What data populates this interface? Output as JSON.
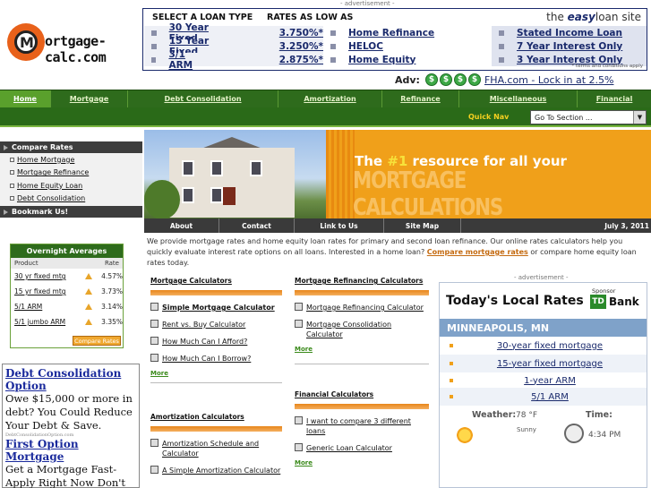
{
  "logo": {
    "letter": "M",
    "wordmark": "ortgage-calc.com"
  },
  "header_ad": {
    "label": "- advertisement -",
    "col_type": "SELECT A LOAN TYPE",
    "col_rates": "RATES AS LOW AS",
    "brand_pre": "the ",
    "brand_bold": "easy",
    "brand_post": "loan site",
    "loans": [
      {
        "name": "30 Year Fixed",
        "rate": "3.750%*"
      },
      {
        "name": "15 Year Fixed",
        "rate": "3.250%*"
      },
      {
        "name": "3/1 ARM",
        "rate": "2.875%*"
      }
    ],
    "mid_links": [
      "Home Refinance",
      "HELOC",
      "Home Equity"
    ],
    "right_links": [
      "Stated Income Loan",
      "7 Year Interest Only",
      "3 Year Interest Only"
    ],
    "terms": "* terms and conditions apply"
  },
  "adv": {
    "label": "Adv:",
    "coin": "$",
    "link": "FHA.com - Lock in at 2.5%"
  },
  "nav": {
    "tabs": [
      "Home",
      "Mortgage",
      "Debt Consolidation",
      "Amortization",
      "Refinance",
      "Miscellaneous",
      "Financial"
    ],
    "quick_nav_label": "Quick Nav",
    "quick_nav_value": "Go To Section ...",
    "arrow": "▼"
  },
  "sidebar": {
    "compare_title": "Compare Rates",
    "compare_items": [
      "Home Mortgage",
      "Mortgage Refinance",
      "Home Equity Loan",
      "Debt Consolidation"
    ],
    "bookmark_title": "Bookmark Us!"
  },
  "overnight": {
    "title": "Overnight Averages",
    "col_product": "Product",
    "col_rate": "Rate",
    "rows": [
      {
        "product": "30 yr fixed mtg",
        "rate": "4.57%"
      },
      {
        "product": "15 yr fixed mtg",
        "rate": "3.73%"
      },
      {
        "product": "5/1 ARM",
        "rate": "3.14%"
      },
      {
        "product": "5/1 jumbo ARM",
        "rate": "3.35%"
      }
    ],
    "button": "Compare Rates"
  },
  "promo": {
    "title1": "Debt Consolidation Option",
    "text1": "Owe $15,000 or more in debt? You Could Reduce Your Debt & Save.",
    "tiny": "DebtConsolidationOption.com",
    "title2": "First Option Mortgage",
    "text2": "Get a Mortgage Fast-Apply Right Now Don't wait for those big banks!"
  },
  "hero": {
    "line1_pre": "The ",
    "line1_accent": "#1",
    "line1_post": " resource for all your",
    "line2": "MORTGAGE CALCULATIONS"
  },
  "subbar": {
    "items": [
      "About",
      "Contact",
      "Link to Us",
      "Site Map"
    ],
    "date": "July 3, 2011"
  },
  "intro": {
    "text_a": "We provide mortgage rates and home equity loan rates for primary and second loan refinance. Our online rates calculators help you quickly evaluate interest rate options on all loans. Interested in a home loan? ",
    "link": "Compare mortgage rates",
    "text_b": " or compare home equity loan rates today."
  },
  "calcs": {
    "mortgage_title": "Mortgage Calculators",
    "mortgage_items": [
      "Simple Mortgage Calculator",
      "Rent vs. Buy Calculator",
      "How Much Can I Afford?",
      "How Much Can I Borrow?"
    ],
    "more": "More",
    "amort_title": "Amortization Calculators",
    "amort_items": [
      "Amortization Schedule and Calculator",
      "A Simple Amortization Calculator"
    ],
    "refi_title": "Mortgage Refinancing Calculators",
    "refi_items": [
      "Mortgage Refinancing Calculator",
      "Mortgage Consolidation Calculator"
    ],
    "fin_title": "Financial Calculators",
    "fin_items": [
      "I want to compare 3 different loans",
      "Generic Loan Calculator"
    ]
  },
  "local_rates": {
    "ad_label": "- advertisement -",
    "title": "Today's Local Rates",
    "sponsor": "Sponsor",
    "bank_mark": "TD",
    "bank": "Bank",
    "city": "MINNEAPOLIS, MN",
    "items": [
      "30-year fixed mortgage",
      "15-year fixed mortgage",
      "1-year ARM",
      "5/1 ARM"
    ],
    "weather_label": "Weather:",
    "weather_value": "78 °F",
    "weather_desc": "Sunny",
    "time_label": "Time:",
    "time_value": "4:34 PM"
  }
}
